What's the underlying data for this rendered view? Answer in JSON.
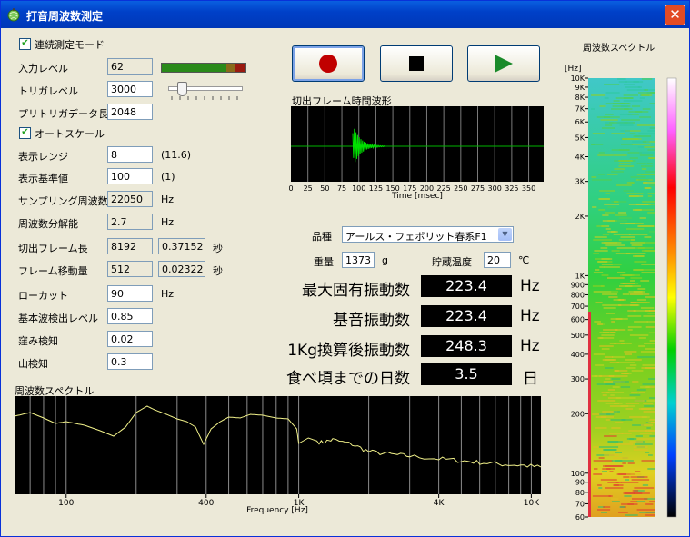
{
  "window": {
    "title": "打音周波数測定"
  },
  "left": {
    "continuous_label": "連続測定モード",
    "autoscale_label": "オートスケール",
    "input_level": {
      "label": "入力レベル",
      "value": "62",
      "level_percent": 78
    },
    "trigger_level": {
      "label": "トリガレベル",
      "value": "3000",
      "slider_percent": 12
    },
    "pretrigger": {
      "label": "プリトリガデータ長",
      "value": "2048"
    },
    "display_range": {
      "label": "表示レンジ",
      "value": "8",
      "note": "(11.6)"
    },
    "display_base": {
      "label": "表示基準値",
      "value": "100",
      "note": "(1)"
    },
    "sampling": {
      "label": "サンプリング周波数",
      "value": "22050",
      "unit": "Hz"
    },
    "resolution": {
      "label": "周波数分解能",
      "value": "2.7",
      "unit": "Hz"
    },
    "frame_len": {
      "label": "切出フレーム長",
      "value": "8192",
      "value2": "0.37152",
      "unit": "秒"
    },
    "frame_shift": {
      "label": "フレーム移動量",
      "value": "512",
      "value2": "0.02322",
      "unit": "秒"
    },
    "lowcut": {
      "label": "ローカット",
      "value": "90",
      "unit": "Hz"
    },
    "fundamental": {
      "label": "基本波検出レベル",
      "value": "0.85"
    },
    "dip": {
      "label": "窪み検知",
      "value": "0.02"
    },
    "peak": {
      "label": "山検知",
      "value": "0.3"
    }
  },
  "waveform": {
    "title": "切出フレーム時間波形",
    "ticks": [
      "0",
      "25",
      "50",
      "75",
      "100",
      "125",
      "150",
      "175",
      "200",
      "225",
      "250",
      "275",
      "300",
      "325",
      "350"
    ],
    "xlabel": "Time [msec]"
  },
  "params": {
    "variety_label": "品種",
    "variety_value": "アールス・フェボリット春系F1",
    "weight_label": "重量",
    "weight_value": "1373",
    "weight_unit": "g",
    "temp_label": "貯蔵温度",
    "temp_value": "20",
    "temp_unit": "℃"
  },
  "results": [
    {
      "label": "最大固有振動数",
      "value": "223.4",
      "unit": "Hz"
    },
    {
      "label": "基音振動数",
      "value": "223.4",
      "unit": "Hz"
    },
    {
      "label": "1Kg換算後振動数",
      "value": "248.3",
      "unit": "Hz"
    },
    {
      "label": "食べ頃までの日数",
      "value": "3.5",
      "unit": "日"
    }
  ],
  "spectrum": {
    "title": "周波数スペクトル",
    "ticks": [
      "100",
      "400",
      "1K",
      "4K",
      "10K"
    ],
    "xlabel": "Frequency [Hz]"
  },
  "spectrogram": {
    "title": "周波数スペクトル",
    "unit_label": "[Hz]",
    "ticks": [
      "10K",
      "9K",
      "8K",
      "7K",
      "6K",
      "5K",
      "4K",
      "3K",
      "2K",
      "1K",
      "900",
      "800",
      "700",
      "600",
      "500",
      "400",
      "300",
      "200",
      "100",
      "90",
      "80",
      "70",
      "60"
    ]
  },
  "colors": {
    "titlebar": "#0040c8",
    "record": "#c00000",
    "play": "#1a8a2a",
    "trace": "#f2f28a",
    "wave": "#00c800"
  }
}
